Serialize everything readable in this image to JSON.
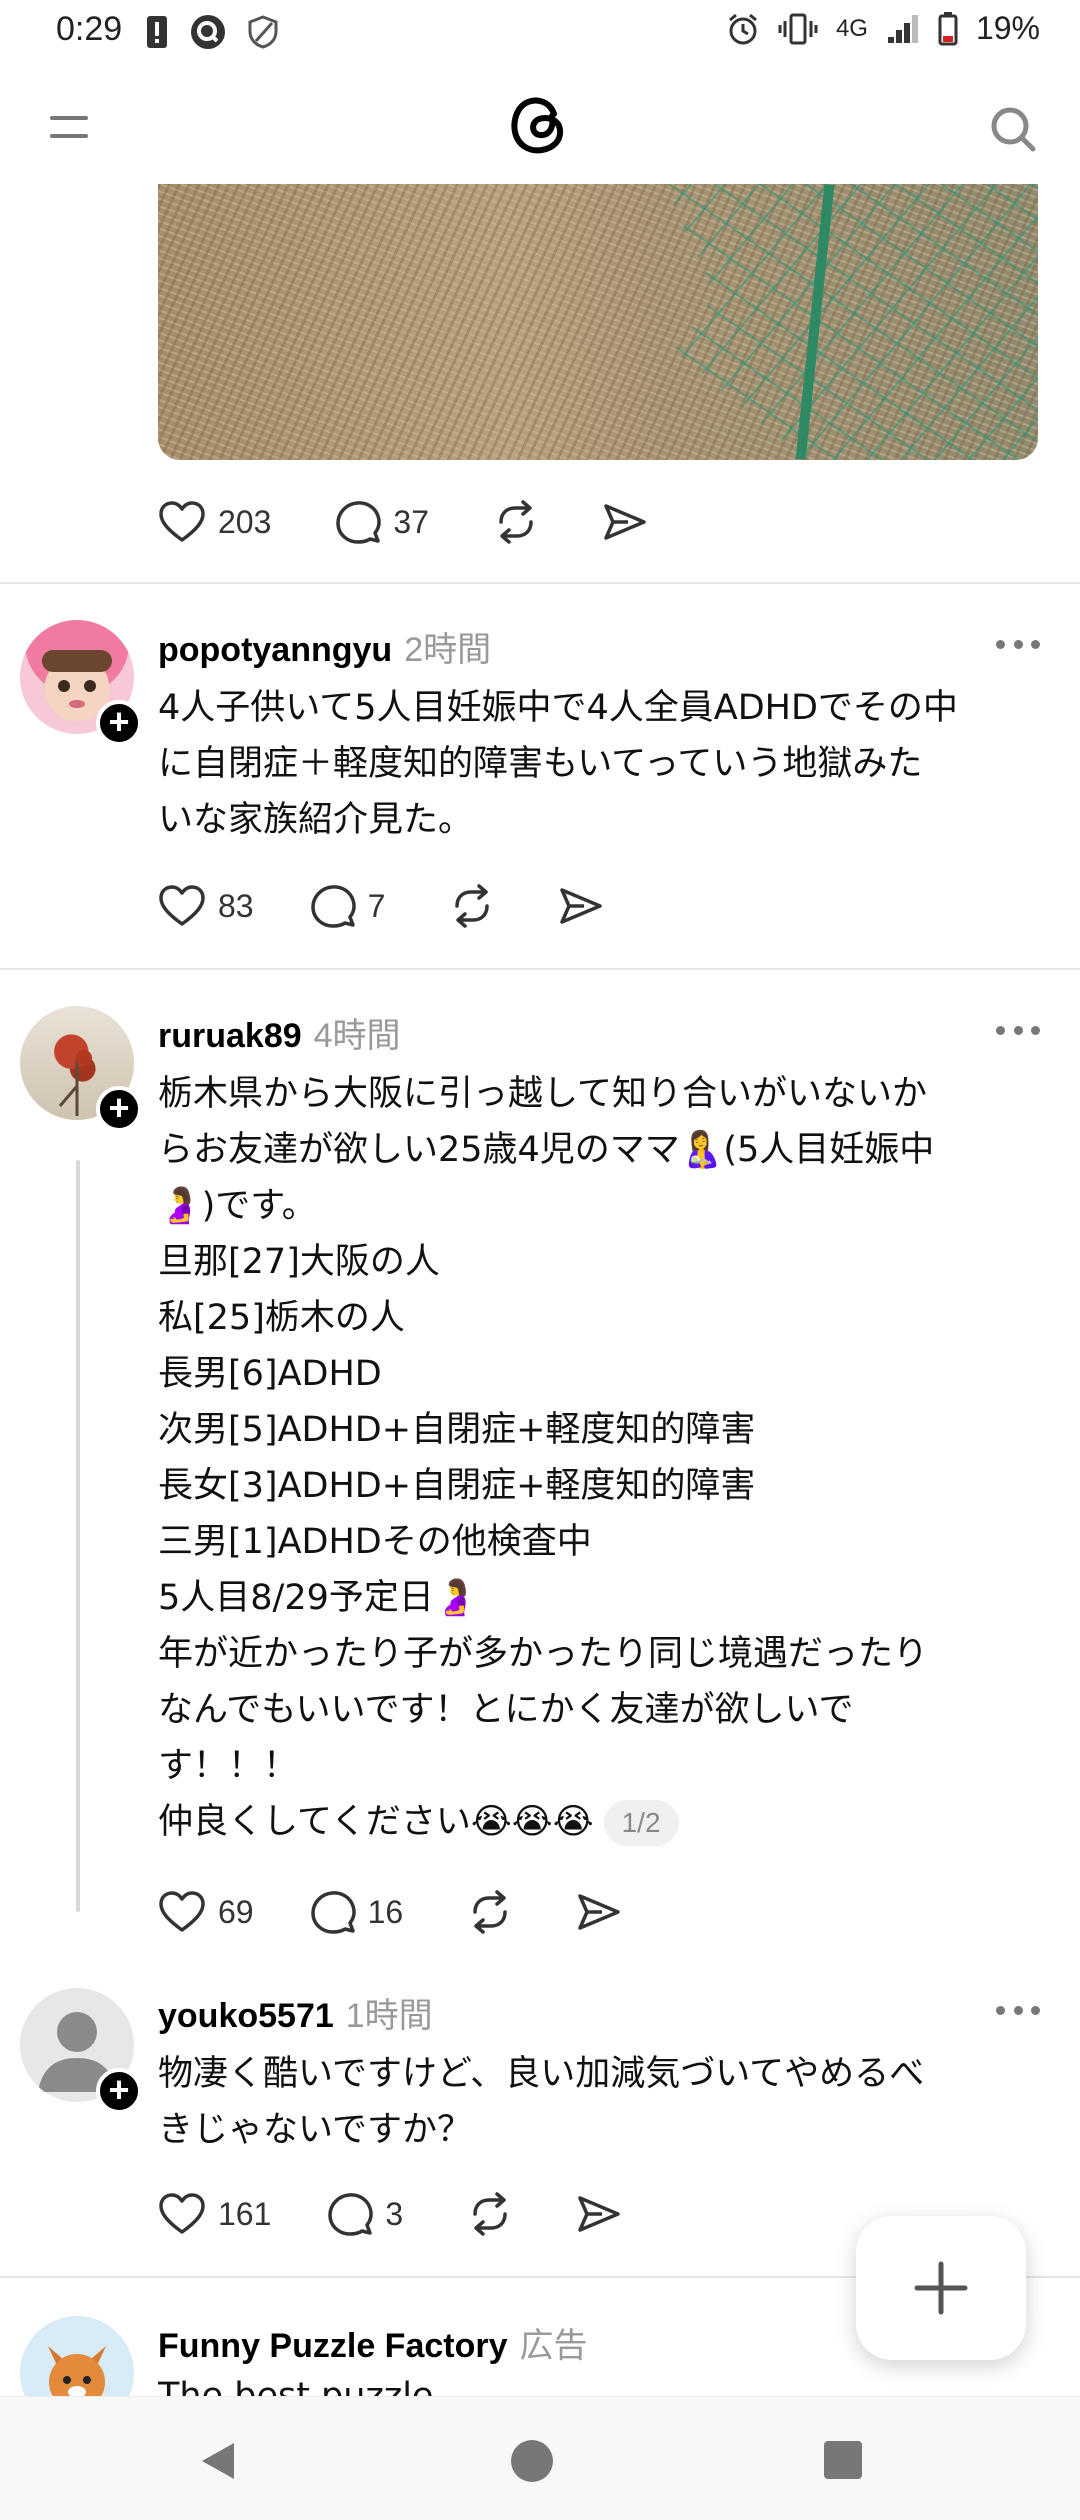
{
  "status_bar": {
    "time": "0:29",
    "network": "4G",
    "battery": "19%"
  },
  "header": {
    "logo_icon": "threads-logo",
    "menu_icon": "menu-icon",
    "search_icon": "search-icon"
  },
  "post0": {
    "likes": "203",
    "replies": "37"
  },
  "post1": {
    "username": "popotyanngyu",
    "time": "2時間",
    "text": "4人子供いて5人目妊娠中で4人全員ADHDでその中\nに自閉症＋軽度知的障害もいてっていう地獄みた\nいな家族紹介見た。",
    "likes": "83",
    "replies": "7"
  },
  "post2": {
    "username": "ruruak89",
    "time": "4時間",
    "lines": [
      "栃木県から大阪に引っ越して知り合いがいないか",
      "らお友達が欲しい25歳4児のママ🤱(5人目妊娠中",
      "🤰)です。",
      "旦那[27]大阪の人",
      "私[25]栃木の人",
      "長男[6]ADHD",
      "次男[5]ADHD+自閉症+軽度知的障害",
      "長女[3]ADHD+自閉症+軽度知的障害",
      "三男[1]ADHDその他検査中",
      "5人目8/29予定日🤰",
      "年が近かったり子が多かったり同じ境遇だったり",
      "なんでもいいです！とにかく友達が欲しいで",
      "す！！！"
    ],
    "last_line": "仲良くしてください😭😭😭",
    "page": "1/2",
    "likes": "69",
    "replies": "16"
  },
  "post3": {
    "username": "youko5571",
    "time": "1時間",
    "text": "物凄く酷いですけど、良い加減気づいてやめるべ\nきじゃないですか？",
    "likes": "161",
    "replies": "3"
  },
  "post4": {
    "username": "Funny Puzzle Factory",
    "tag": "広告",
    "text": "The best puzzle ... "
  },
  "fab": {
    "icon": "plus-icon"
  },
  "nav": {
    "back_icon": "back-triangle-icon",
    "home_icon": "home-circle-icon",
    "recents_icon": "recents-square-icon"
  },
  "colors": {
    "accent": "#000000",
    "muted": "#999999",
    "divider": "#e6e6e6"
  }
}
